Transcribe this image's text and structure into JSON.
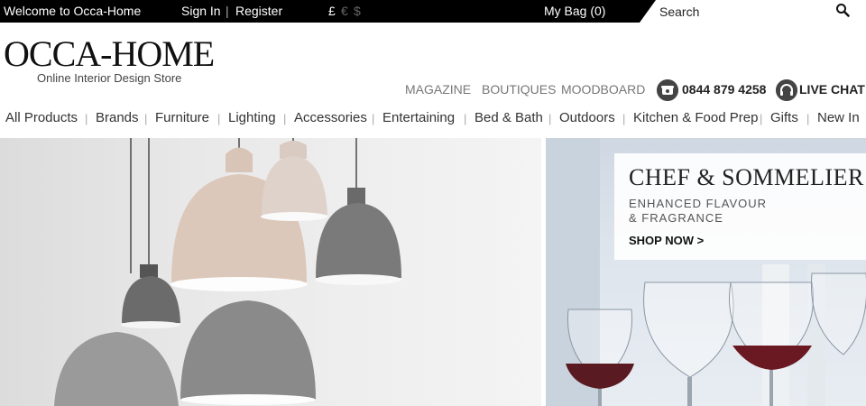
{
  "topbar": {
    "welcome": "Welcome to Occa-Home",
    "signin": "Sign In",
    "separator": "|",
    "register": "Register",
    "currencies": [
      "£",
      "€",
      "$"
    ],
    "bag": "My Bag (0)",
    "search_placeholder": "Search"
  },
  "header": {
    "logo": "OCCA-HOME",
    "tagline": "Online Interior Design Store",
    "secondary_nav": [
      "MAGAZINE",
      "BOUTIQUES",
      "MOODBOARD"
    ],
    "phone": "0844 879 4258",
    "live_chat": "LIVE CHAT"
  },
  "main_nav": [
    "All Products",
    "Brands",
    "Furniture",
    "Lighting",
    "Accessories",
    "Entertaining",
    "Bed & Bath",
    "Outdoors",
    "Kitchen & Food Prep",
    "Gifts",
    "New In"
  ],
  "promo": {
    "title": "CHEF & SOMMELIER",
    "subtitle_line1": "ENHANCED FLAVOUR",
    "subtitle_line2": "& FRAGRANCE",
    "cta": "SHOP NOW >"
  },
  "icons": {
    "search": "search-icon",
    "phone": "phone-icon",
    "chat": "headset-icon"
  },
  "colors": {
    "topbar_bg": "#000000",
    "text_dark": "#222222",
    "nav_grey": "#777777"
  }
}
